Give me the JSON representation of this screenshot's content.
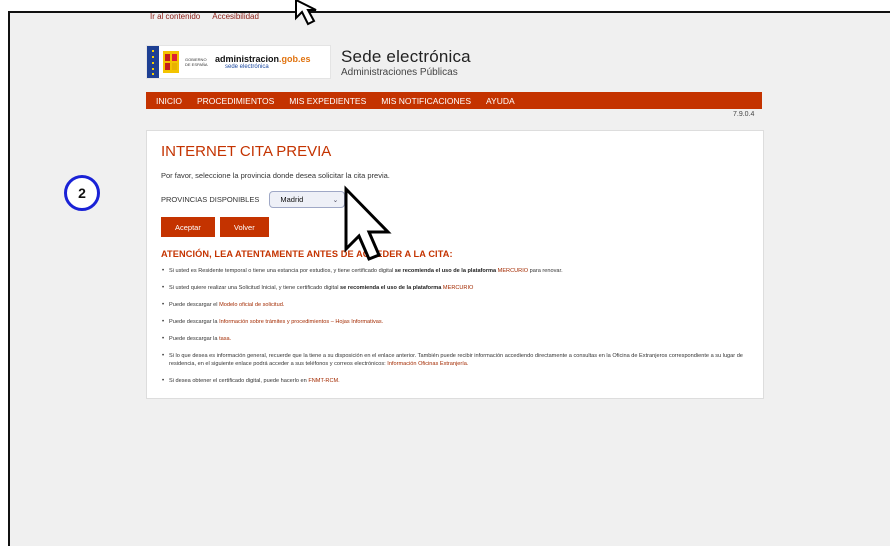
{
  "skip_links": [
    "Ir al contenido",
    "Accesibilidad"
  ],
  "header": {
    "gov_label": "GOBIERNO DE ESPAÑA",
    "admin_logo": {
      "part1": "administracion",
      "part2": ".gob.es",
      "sub": "sede electrónica"
    },
    "title": "Sede electrónica",
    "subtitle": "Administraciones Públicas"
  },
  "nav": [
    "INICIO",
    "PROCEDIMIENTOS",
    "MIS EXPEDIENTES",
    "MIS NOTIFICACIONES",
    "AYUDA"
  ],
  "version": "7.9.0.4",
  "panel": {
    "title": "INTERNET CITA PREVIA",
    "intro": "Por favor, seleccione la provincia donde desea solicitar la cita previa.",
    "province_label": "PROVINCIAS DISPONIBLES",
    "province_selected": "Madrid",
    "accept": "Aceptar",
    "back": "Volver",
    "warning": "ATENCIÓN, LEA ATENTAMENTE ANTES DE ACCEDER A LA CITA:",
    "bullets": {
      "b1": {
        "pre": "Si usted es Residente temporal o tiene una estancia por estudios, y tiene certificado digital ",
        "bold": "se recomienda el uso de la plataforma ",
        "link": "MERCURIO",
        "post": " para renovar."
      },
      "b2": {
        "pre": "Si usted quiere realizar una Solicitud Inicial, y tiene certificado digital ",
        "bold": "se recomienda el uso de la plataforma ",
        "link": "MERCURIO"
      },
      "b3": {
        "pre": "Puede descargar el ",
        "link": "Modelo oficial de solicitud."
      },
      "b4": {
        "pre": "Puede descargar la ",
        "link": "Información sobre trámites y procedimientos – Hojas Informativas."
      },
      "b5": {
        "pre": "Puede descargar la ",
        "link": "tasa."
      },
      "b6": {
        "pre": "Si lo que desea es información general, recuerde que la tiene a su disposición en el enlace anterior. También puede recibir información accediendo directamente a consultas en la Oficina de Extranjeros correspondiente a su lugar de residencia, en el siguiente enlace podrá acceder a sus teléfonos y correos electrónicos: ",
        "link": "Información Oficinas Extranjería."
      },
      "b7": {
        "pre": "Si desea obtener el certificado digital, puede hacerlo en ",
        "link": "FNMT-RCM."
      }
    }
  },
  "step_badge": "2",
  "colors": {
    "accent": "#c43300",
    "badge_ring": "#1a22d6",
    "page_bg": "#f0f0f0"
  },
  "icons": [
    "arrow-cursor-icon",
    "eu-flag-icon",
    "spain-shield-icon",
    "chevron-down-icon"
  ]
}
